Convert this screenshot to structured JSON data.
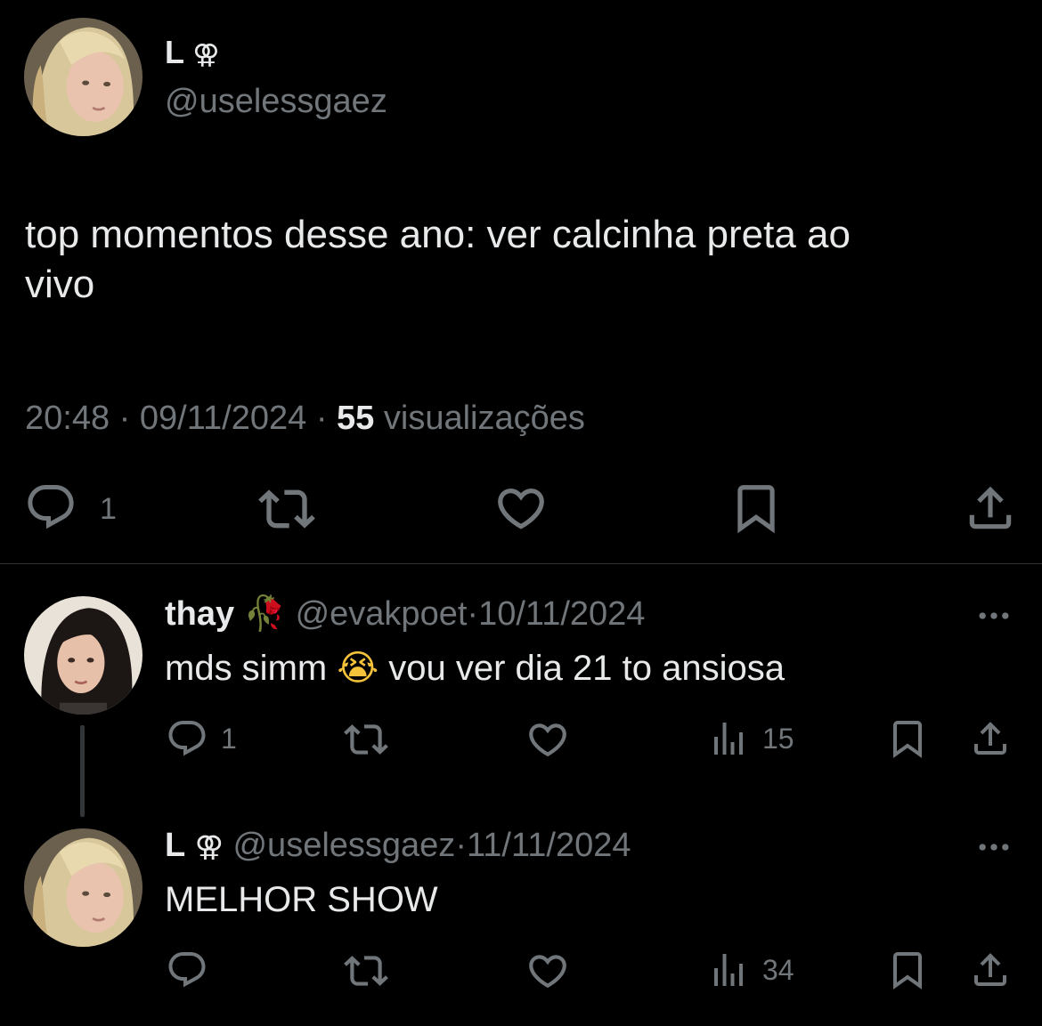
{
  "main_tweet": {
    "display_name": "L",
    "name_emoji": "⚢",
    "handle": "@uselessgaez",
    "text_line1": "top momentos desse ano: ver calcinha preta ao",
    "text_line2": "vivo",
    "time": "20:48",
    "sep1": "·",
    "date": "09/11/2024",
    "sep2": "·",
    "views_count": "55",
    "views_label": "visualizações",
    "reply_count": "1"
  },
  "reply1": {
    "display_name": "thay",
    "name_emoji": "🥀",
    "handle": "@evakpoet",
    "sep": "·",
    "date": "10/11/2024",
    "text_before": "mds simm",
    "text_emoji": "😭",
    "text_after": "vou ver dia 21 to ansiosa",
    "reply_count": "1",
    "views_count": "15"
  },
  "reply2": {
    "display_name": "L",
    "name_emoji": "⚢",
    "handle": "@uselessgaez",
    "sep": "·",
    "date": "11/11/2024",
    "text": "MELHOR SHOW",
    "views_count": "34"
  },
  "colors": {
    "background": "#000000",
    "text": "#e7e9ea",
    "muted": "#71767b",
    "divider": "#2f3336"
  }
}
